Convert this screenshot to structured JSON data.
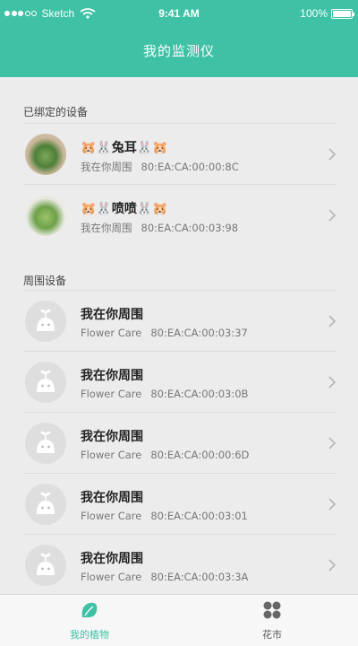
{
  "status_bar": {
    "carrier": "Sketch",
    "time": "9:41 AM",
    "battery": "100%",
    "battery_level": 1.0
  },
  "header": {
    "title": "我的监测仪"
  },
  "bound_section": {
    "label": "已绑定的设备",
    "devices": [
      {
        "name": "🐹🐰兔耳🐰🐹",
        "location": "我在你周围",
        "mac": "80:EA:CA:00:00:8C"
      },
      {
        "name": "🐹🐰喷喷🐰🐹",
        "location": "我在你周围",
        "mac": "80:EA:CA:00:03:98"
      }
    ]
  },
  "nearby_section": {
    "label": "周围设备",
    "devices": [
      {
        "name": "我在你周围",
        "model": "Flower Care",
        "mac": "80:EA:CA:00:03:37"
      },
      {
        "name": "我在你周围",
        "model": "Flower Care",
        "mac": "80:EA:CA:00:03:0B"
      },
      {
        "name": "我在你周围",
        "model": "Flower Care",
        "mac": "80:EA:CA:00:00:6D"
      },
      {
        "name": "我在你周围",
        "model": "Flower Care",
        "mac": "80:EA:CA:00:03:01"
      },
      {
        "name": "我在你周围",
        "model": "Flower Care",
        "mac": "80:EA:CA:00:03:3A"
      }
    ]
  },
  "tabbar": {
    "tabs": [
      {
        "label": "我的植物",
        "icon": "plant-leaf-icon",
        "active": true
      },
      {
        "label": "花市",
        "icon": "four-petal-icon",
        "active": false
      }
    ]
  },
  "colors": {
    "accent": "#3fc1a5",
    "background": "#ececec"
  }
}
